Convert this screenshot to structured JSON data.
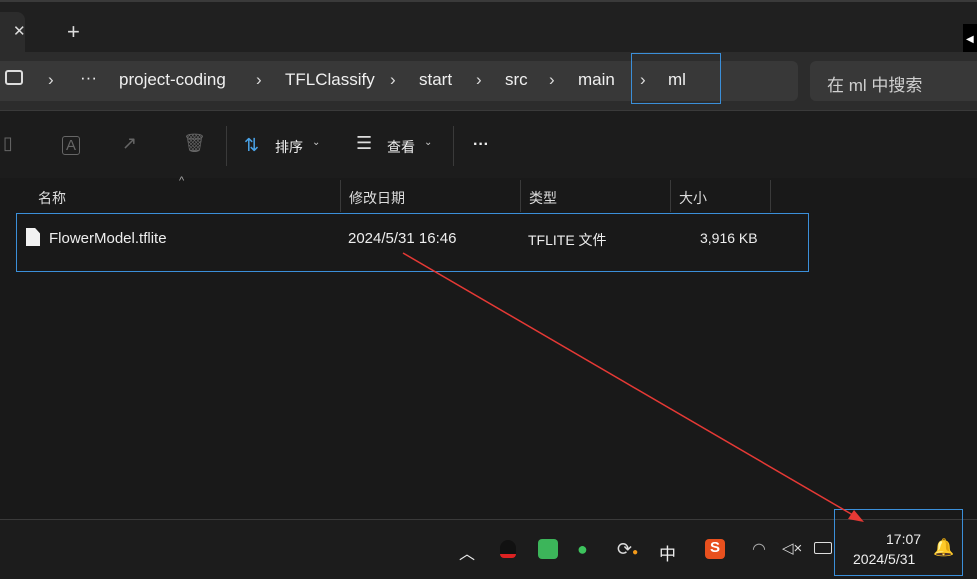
{
  "tabs": {
    "close": "✕",
    "new": "+"
  },
  "breadcrumb": {
    "items": [
      "project-coding",
      "TFLClassify",
      "start",
      "src",
      "main",
      "ml"
    ],
    "overflow": "···"
  },
  "search": {
    "placeholder": "在 ml 中搜索"
  },
  "toolbar": {
    "sort": "排序",
    "view": "查看",
    "more": "···"
  },
  "columns": [
    "名称",
    "修改日期",
    "类型",
    "大小"
  ],
  "files": [
    {
      "name": "FlowerModel.tflite",
      "modified": "2024/5/31 16:46",
      "type": "TFLITE 文件",
      "size": "3,916 KB"
    }
  ],
  "taskbar": {
    "ime": "中",
    "time": "17:07",
    "date": "2024/5/31"
  },
  "colors": {
    "accent": "#3b8fd9",
    "annotation": "#e53935"
  }
}
